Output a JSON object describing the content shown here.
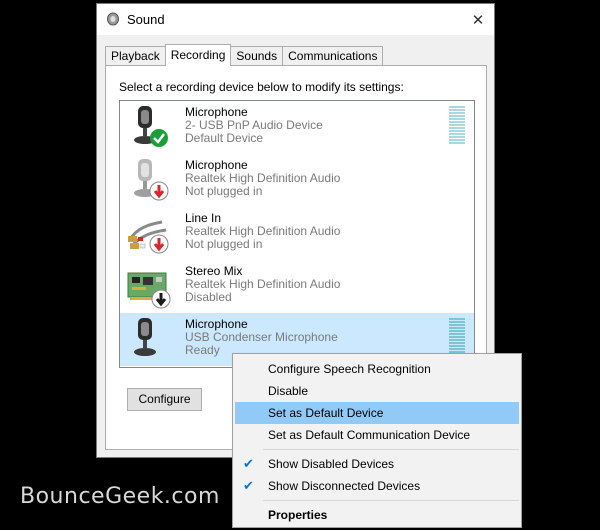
{
  "window": {
    "title": "Sound",
    "close_glyph": "✕"
  },
  "tabs": [
    {
      "label": "Playback",
      "active": false
    },
    {
      "label": "Recording",
      "active": true
    },
    {
      "label": "Sounds",
      "active": false
    },
    {
      "label": "Communications",
      "active": false
    }
  ],
  "instructions": "Select a recording device below to modify its settings:",
  "devices": [
    {
      "name": "Microphone",
      "line2": "2- USB PnP Audio Device",
      "status": "Default Device",
      "icon": "microphone-icon",
      "badge": "check-badge-icon",
      "meter": true
    },
    {
      "name": "Microphone",
      "line2": "Realtek High Definition Audio",
      "status": "Not plugged in",
      "icon": "microphone-icon",
      "badge": "down-arrow-badge-icon",
      "meter": false
    },
    {
      "name": "Line In",
      "line2": "Realtek High Definition Audio",
      "status": "Not plugged in",
      "icon": "line-in-cable-icon",
      "badge": "down-arrow-badge-icon",
      "meter": false
    },
    {
      "name": "Stereo Mix",
      "line2": "Realtek High Definition Audio",
      "status": "Disabled",
      "icon": "circuit-board-icon",
      "badge": "down-arrow-badge-icon",
      "meter": false
    },
    {
      "name": "Microphone",
      "line2": "USB Condenser Microphone",
      "status": "Ready",
      "icon": "microphone-icon",
      "badge": "",
      "meter": true,
      "selected": true
    }
  ],
  "buttons": {
    "configure": "Configure"
  },
  "context_menu": {
    "items": [
      {
        "label": "Configure Speech Recognition"
      },
      {
        "label": "Disable"
      },
      {
        "label": "Set as Default Device",
        "highlighted": true
      },
      {
        "label": "Set as Default Communication Device"
      },
      {
        "label": "Show Disabled Devices",
        "checked": true
      },
      {
        "label": "Show Disconnected Devices",
        "checked": true
      },
      {
        "label": "Properties",
        "bold": true
      }
    ],
    "check_glyph": "✔"
  },
  "watermark": "BounceGeek.com",
  "colors": {
    "selection": "#cce8ff",
    "menu_highlight": "#91c9f7",
    "check_green": "#1a9e3a",
    "badge_red": "#d9262b",
    "badge_black": "#1a1a1a"
  }
}
